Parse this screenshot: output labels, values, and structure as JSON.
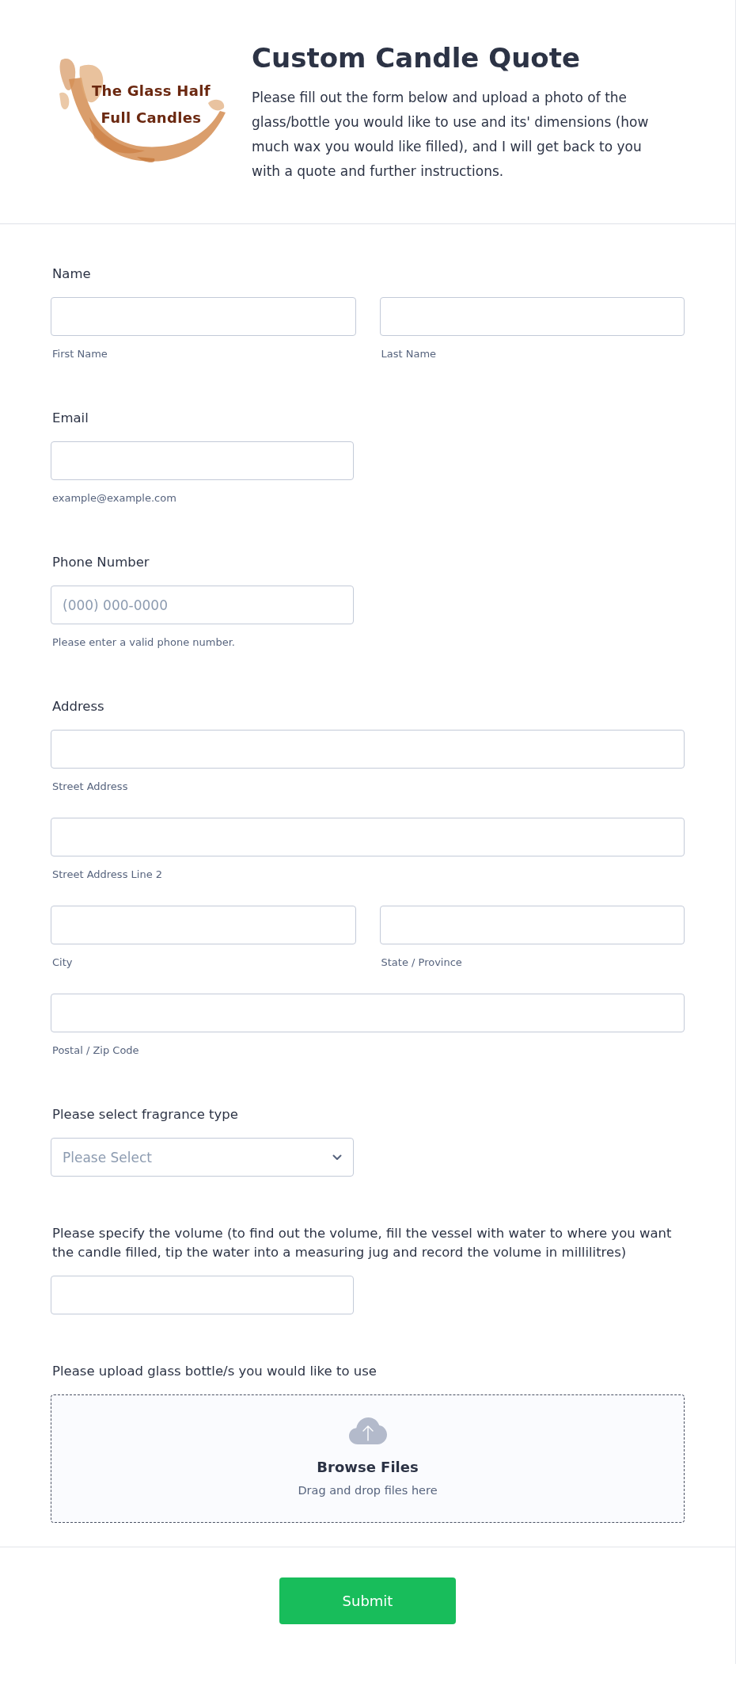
{
  "header": {
    "logo": {
      "lines": [
        "The Glass Half",
        "Full Candles"
      ]
    },
    "title": "Custom Candle Quote",
    "description": "Please fill out the form below and upload a photo of the glass/bottle you would like to use and its' dimensions (how much wax you would like filled), and I will get back to you with a quote and further instructions."
  },
  "fields": [
    {
      "kind": "grid",
      "label": "Name",
      "rows": [
        [
          {
            "sublabel": "First Name"
          },
          {
            "sublabel": "Last Name"
          }
        ]
      ]
    },
    {
      "kind": "short",
      "label": "Email",
      "sublabel": "example@example.com"
    },
    {
      "kind": "short",
      "label": "Phone Number",
      "placeholder": "(000) 000-0000",
      "sublabel": "Please enter a valid phone number."
    },
    {
      "kind": "grid",
      "label": "Address",
      "rows": [
        [
          {
            "sublabel": "Street Address"
          }
        ],
        [
          {
            "sublabel": "Street Address Line 2"
          }
        ],
        [
          {
            "sublabel": "City"
          },
          {
            "sublabel": "State / Province"
          }
        ],
        [
          {
            "sublabel": "Postal / Zip Code"
          }
        ]
      ]
    },
    {
      "kind": "dropdown",
      "label": "Please select fragrance type",
      "placeholder": "Please Select"
    },
    {
      "kind": "short",
      "label": "Please specify the volume (to find out the volume, fill the vessel with water to where you want the candle filled, tip the water into a measuring jug and record the volume in millilitres)"
    },
    {
      "kind": "upload",
      "label": "Please upload glass bottle/s you would like to use",
      "button": "Browse Files",
      "hint": "Drag and drop files here"
    }
  ],
  "submit": "Submit"
}
